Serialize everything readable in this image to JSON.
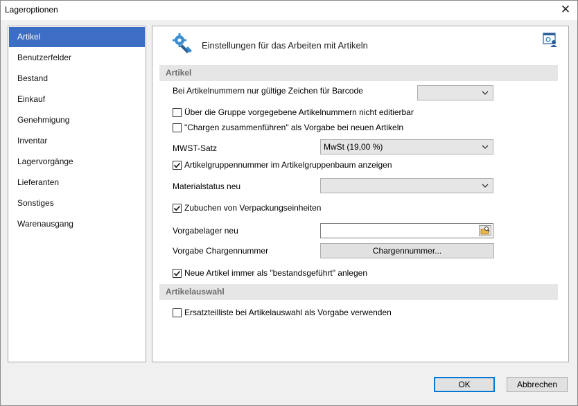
{
  "window": {
    "title": "Lageroptionen",
    "close_glyph": "✕"
  },
  "sidebar": {
    "items": [
      {
        "label": "Artikel"
      },
      {
        "label": "Benutzerfelder"
      },
      {
        "label": "Bestand"
      },
      {
        "label": "Einkauf"
      },
      {
        "label": "Genehmigung"
      },
      {
        "label": "Inventar"
      },
      {
        "label": "Lagervorgänge"
      },
      {
        "label": "Lieferanten"
      },
      {
        "label": "Sonstiges"
      },
      {
        "label": "Warenausgang"
      }
    ],
    "active_item": "Artikel"
  },
  "content": {
    "header_title": "Einstellungen für das Arbeiten mit Artikeln",
    "header_icon": "gear-bolt-icon",
    "help_icon": "settings-user-icon",
    "section_artikel": "Artikel",
    "barcode_label": "Bei Artikelnummern nur gültige Zeichen für Barcode",
    "barcode_value": "",
    "check_group_numbers": {
      "label": "Über die Gruppe vorgegebene Artikelnummern nicht editierbar",
      "checked": false
    },
    "check_merge_batches": {
      "label": "\"Chargen zusammenführen\" als Vorgabe bei neuen Artikeln",
      "checked": false
    },
    "vat_label": "MWST-Satz",
    "vat_value": "MwSt (19,00 %)",
    "check_group_tree": {
      "label": "Artikelgruppennummer im Artikelgruppenbaum anzeigen",
      "checked": true
    },
    "material_status_label": "Materialstatus neu",
    "material_status_value": "",
    "check_packaging": {
      "label": "Zubuchen von Verpackungseinheiten",
      "checked": true
    },
    "default_storage_label": "Vorgabelager neu",
    "default_storage_value": "",
    "batch_number_label": "Vorgabe Chargennummer",
    "batch_number_button": "Chargennummer...",
    "check_stock_managed": {
      "label": "Neue Artikel immer als \"bestandsgeführt\" anlegen",
      "checked": true
    },
    "section_selection": "Artikelauswahl",
    "check_spare_parts": {
      "label": "Ersatzteilliste bei Artikelauswahl als Vorgabe verwenden",
      "checked": false
    }
  },
  "footer": {
    "ok_label": "OK",
    "cancel_label": "Abbrechen"
  },
  "colors": {
    "accent": "#3c6ec5",
    "focus_border": "#0078d7",
    "section_bg": "#e6e6e6"
  }
}
